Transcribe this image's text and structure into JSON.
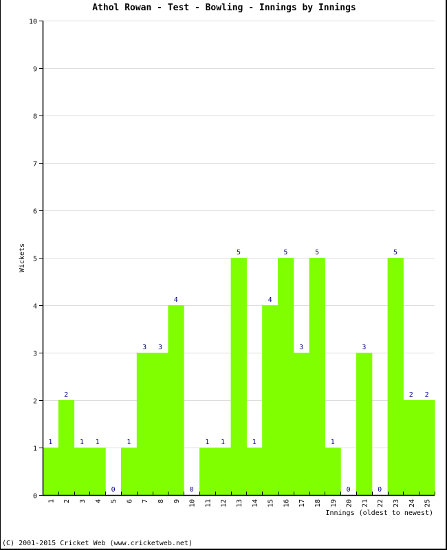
{
  "chart_data": {
    "type": "bar",
    "title": "Athol Rowan - Test - Bowling - Innings by Innings",
    "xlabel": "Innings (oldest to newest)",
    "ylabel": "Wickets",
    "ylim": [
      0,
      10
    ],
    "yticks": [
      0,
      1,
      2,
      3,
      4,
      5,
      6,
      7,
      8,
      9,
      10
    ],
    "grid": true,
    "bar_color": "#80ff00",
    "value_label_color": "#000080",
    "categories": [
      "1",
      "2",
      "3",
      "4",
      "5",
      "6",
      "7",
      "8",
      "9",
      "10",
      "11",
      "12",
      "13",
      "14",
      "15",
      "16",
      "17",
      "18",
      "19",
      "20",
      "21",
      "22",
      "23",
      "24",
      "25"
    ],
    "values": [
      1,
      2,
      1,
      1,
      0,
      1,
      3,
      3,
      4,
      0,
      1,
      1,
      5,
      1,
      4,
      5,
      3,
      5,
      1,
      0,
      3,
      0,
      5,
      2,
      2
    ]
  },
  "footer": {
    "copyright": "(C) 2001-2015 Cricket Web (www.cricketweb.net)"
  }
}
